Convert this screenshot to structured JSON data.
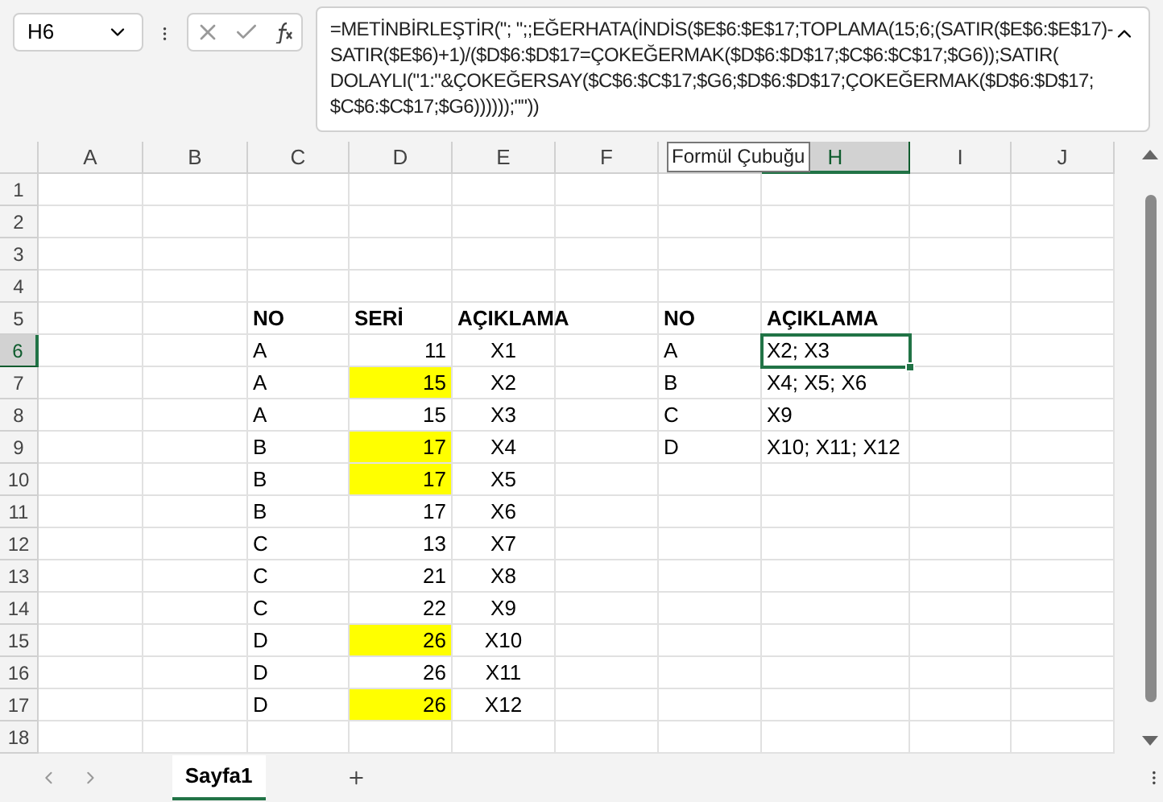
{
  "name_box": "H6",
  "formula_lines": [
    "=METİNBİRLEŞTİR(\"; \";;EĞERHATA(İNDİS($E$6:$E$17;TOPLAMA(15;6;(SATIR($E$6:$E$17)-",
    "SATIR($E$6)+1)/($D$6:$D$17=ÇOKEĞERMAK($D$6:$D$17;$C$6:$C$17;$G6));SATIR(",
    "DOLAYLI(\"1:\"&ÇOKEĞERSAY($C$6:$C$17;$G6;$D$6:$D$17;ÇOKEĞERMAK($D$6:$D$17;",
    "$C$6:$C$17;$G6))))));\"\"))"
  ],
  "tooltip": "Formül Çubuğu",
  "columns": [
    {
      "label": "A",
      "selected": false
    },
    {
      "label": "B",
      "selected": false
    },
    {
      "label": "C",
      "selected": false
    },
    {
      "label": "D",
      "selected": false
    },
    {
      "label": "E",
      "selected": false
    },
    {
      "label": "F",
      "selected": false
    },
    {
      "selected": false
    },
    {
      "label": "H",
      "selected": true
    },
    {
      "label": "I",
      "selected": false
    },
    {
      "label": "J",
      "selected": false
    }
  ],
  "rows": [
    {
      "number": "1",
      "selected": false,
      "cells": []
    },
    {
      "number": "2",
      "selected": false,
      "cells": []
    },
    {
      "number": "3",
      "selected": false,
      "cells": []
    },
    {
      "number": "4",
      "selected": false,
      "cells": []
    },
    {
      "number": "5",
      "selected": false,
      "cells": [
        null,
        null,
        {
          "text": "NO",
          "kind": "header"
        },
        {
          "text": "SERİ",
          "kind": "header"
        },
        {
          "text": "AÇIKLAMA",
          "kind": "header"
        },
        null,
        {
          "text": "NO",
          "kind": "header"
        },
        {
          "text": "AÇIKLAMA",
          "kind": "header"
        }
      ]
    },
    {
      "number": "6",
      "selected": true,
      "cells": [
        null,
        null,
        {
          "text": "A",
          "kind": "text"
        },
        {
          "text": "11",
          "kind": "number",
          "highlighted": false
        },
        {
          "text": "X1",
          "kind": "center"
        },
        null,
        {
          "text": "A",
          "kind": "text"
        },
        {
          "text": "X2; X3",
          "kind": "text",
          "selected": true
        }
      ]
    },
    {
      "number": "7",
      "selected": false,
      "cells": [
        null,
        null,
        {
          "text": "A",
          "kind": "text"
        },
        {
          "text": "15",
          "kind": "number",
          "highlighted": true
        },
        {
          "text": "X2",
          "kind": "center"
        },
        null,
        {
          "text": "B",
          "kind": "text"
        },
        {
          "text": "X4; X5; X6",
          "kind": "text",
          "selected": false
        }
      ]
    },
    {
      "number": "8",
      "selected": false,
      "cells": [
        null,
        null,
        {
          "text": "A",
          "kind": "text"
        },
        {
          "text": "15",
          "kind": "number",
          "highlighted": false
        },
        {
          "text": "X3",
          "kind": "center"
        },
        null,
        {
          "text": "C",
          "kind": "text"
        },
        {
          "text": "X9",
          "kind": "text",
          "selected": false
        }
      ]
    },
    {
      "number": "9",
      "selected": false,
      "cells": [
        null,
        null,
        {
          "text": "B",
          "kind": "text"
        },
        {
          "text": "17",
          "kind": "number",
          "highlighted": true
        },
        {
          "text": "X4",
          "kind": "center"
        },
        null,
        {
          "text": "D",
          "kind": "text"
        },
        {
          "text": "X10; X11; X12",
          "kind": "text",
          "selected": false
        }
      ]
    },
    {
      "number": "10",
      "selected": false,
      "cells": [
        null,
        null,
        {
          "text": "B",
          "kind": "text"
        },
        {
          "text": "17",
          "kind": "number",
          "highlighted": true
        },
        {
          "text": "X5",
          "kind": "center"
        }
      ]
    },
    {
      "number": "11",
      "selected": false,
      "cells": [
        null,
        null,
        {
          "text": "B",
          "kind": "text"
        },
        {
          "text": "17",
          "kind": "number",
          "highlighted": false
        },
        {
          "text": "X6",
          "kind": "center"
        }
      ]
    },
    {
      "number": "12",
      "selected": false,
      "cells": [
        null,
        null,
        {
          "text": "C",
          "kind": "text"
        },
        {
          "text": "13",
          "kind": "number",
          "highlighted": false
        },
        {
          "text": "X7",
          "kind": "center"
        }
      ]
    },
    {
      "number": "13",
      "selected": false,
      "cells": [
        null,
        null,
        {
          "text": "C",
          "kind": "text"
        },
        {
          "text": "21",
          "kind": "number",
          "highlighted": false
        },
        {
          "text": "X8",
          "kind": "center"
        }
      ]
    },
    {
      "number": "14",
      "selected": false,
      "cells": [
        null,
        null,
        {
          "text": "C",
          "kind": "text"
        },
        {
          "text": "22",
          "kind": "number",
          "highlighted": false
        },
        {
          "text": "X9",
          "kind": "center"
        }
      ]
    },
    {
      "number": "15",
      "selected": false,
      "cells": [
        null,
        null,
        {
          "text": "D",
          "kind": "text"
        },
        {
          "text": "26",
          "kind": "number",
          "highlighted": true
        },
        {
          "text": "X10",
          "kind": "center"
        }
      ]
    },
    {
      "number": "16",
      "selected": false,
      "cells": [
        null,
        null,
        {
          "text": "D",
          "kind": "text"
        },
        {
          "text": "26",
          "kind": "number",
          "highlighted": false
        },
        {
          "text": "X11",
          "kind": "center"
        }
      ]
    },
    {
      "number": "17",
      "selected": false,
      "cells": [
        null,
        null,
        {
          "text": "D",
          "kind": "text"
        },
        {
          "text": "26",
          "kind": "number",
          "highlighted": true
        },
        {
          "text": "X12",
          "kind": "center"
        }
      ]
    },
    {
      "number": "18",
      "selected": false,
      "cells": []
    }
  ],
  "sheet_tabs": [
    {
      "label": "Sayfa1",
      "selected": true
    }
  ]
}
